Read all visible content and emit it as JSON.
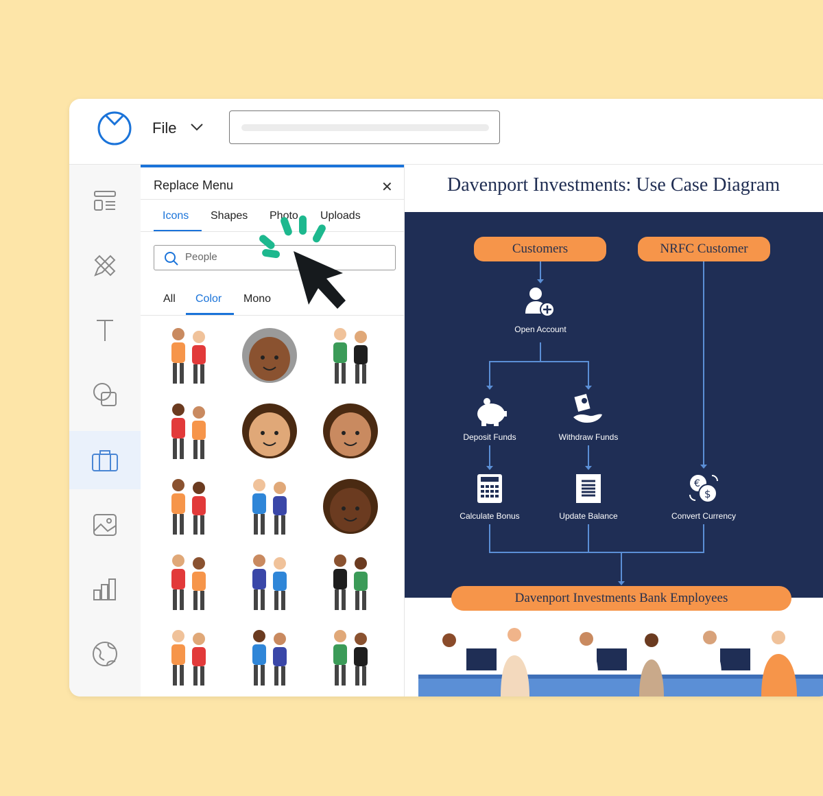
{
  "header": {
    "file_label": "File"
  },
  "sidebar": {
    "items": [
      {
        "icon": "layout-icon"
      },
      {
        "icon": "pencil-ruler-icon"
      },
      {
        "icon": "text-icon"
      },
      {
        "icon": "shapes-icon"
      },
      {
        "icon": "briefcase-icon",
        "active": true
      },
      {
        "icon": "image-icon"
      },
      {
        "icon": "chart-icon"
      },
      {
        "icon": "globe-icon"
      }
    ]
  },
  "panel": {
    "title": "Replace Menu",
    "tabs": [
      "Icons",
      "Shapes",
      "Photo",
      "Uploads"
    ],
    "active_tab": "Icons",
    "search": {
      "value": "People"
    },
    "filters": [
      "All",
      "Color",
      "Mono"
    ],
    "active_filter": "Color"
  },
  "diagram": {
    "title": "Davenport Investments: Use Case Diagram",
    "actors": [
      "Customers",
      "NRFC Customer"
    ],
    "use_cases": [
      "Open Account",
      "Deposit Funds",
      "Withdraw Funds",
      "Calculate Bonus",
      "Update Balance",
      "Convert Currency"
    ],
    "bottom_actor": "Davenport Investments Bank Employees"
  },
  "colors": {
    "accent": "#1a73d9",
    "navy": "#1f2e55",
    "orange": "#f6954a",
    "background": "#fde5a8",
    "spark": "#1db88e"
  }
}
